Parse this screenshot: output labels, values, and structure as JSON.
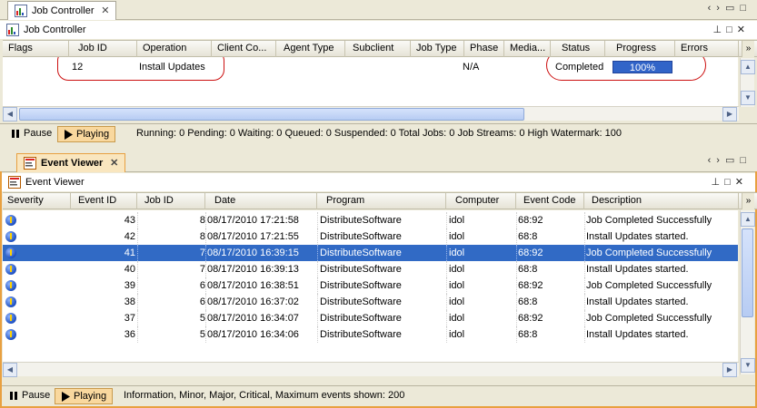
{
  "job_controller": {
    "tab_label": "Job Controller",
    "title": "Job Controller",
    "columns": [
      "Flags",
      "Job ID",
      "Operation",
      "Client Co...",
      "Agent Type",
      "Subclient",
      "Job Type",
      "Phase",
      "Media...",
      "Status",
      "Progress",
      "Errors"
    ],
    "job": {
      "job_id": "12",
      "operation": "Install Updates",
      "phase": "N/A",
      "status": "Completed",
      "progress_label": "100%",
      "progress": 1.0
    },
    "pause_label": "Pause",
    "playing_label": "Playing",
    "status_text": "Running: 0 Pending: 0 Waiting: 0 Queued: 0 Suspended: 0 Total Jobs: 0 Job Streams: 0 High Watermark: 100"
  },
  "event_viewer": {
    "tab_label": "Event Viewer",
    "title": "Event Viewer",
    "columns": [
      "Severity",
      "Event ID",
      "Job ID",
      "Date",
      "Program",
      "Computer",
      "Event Code",
      "Description"
    ],
    "rows": [
      {
        "event_id": "43",
        "job_id": "8",
        "date": "08/17/2010 17:21:58",
        "program": "DistributeSoftware",
        "computer": "idol",
        "code": "68:92",
        "description": "Job Completed Successfully"
      },
      {
        "event_id": "42",
        "job_id": "8",
        "date": "08/17/2010 17:21:55",
        "program": "DistributeSoftware",
        "computer": "idol",
        "code": "68:8",
        "description": "Install Updates started."
      },
      {
        "event_id": "41",
        "job_id": "7",
        "date": "08/17/2010 16:39:15",
        "program": "DistributeSoftware",
        "computer": "idol",
        "code": "68:92",
        "description": "Job Completed Successfully"
      },
      {
        "event_id": "40",
        "job_id": "7",
        "date": "08/17/2010 16:39:13",
        "program": "DistributeSoftware",
        "computer": "idol",
        "code": "68:8",
        "description": "Install Updates started."
      },
      {
        "event_id": "39",
        "job_id": "6",
        "date": "08/17/2010 16:38:51",
        "program": "DistributeSoftware",
        "computer": "idol",
        "code": "68:92",
        "description": "Job Completed Successfully"
      },
      {
        "event_id": "38",
        "job_id": "6",
        "date": "08/17/2010 16:37:02",
        "program": "DistributeSoftware",
        "computer": "idol",
        "code": "68:8",
        "description": "Install Updates started."
      },
      {
        "event_id": "37",
        "job_id": "5",
        "date": "08/17/2010 16:34:07",
        "program": "DistributeSoftware",
        "computer": "idol",
        "code": "68:92",
        "description": "Job Completed Successfully"
      },
      {
        "event_id": "36",
        "job_id": "5",
        "date": "08/17/2010 16:34:06",
        "program": "DistributeSoftware",
        "computer": "idol",
        "code": "68:8",
        "description": "Install Updates started."
      }
    ],
    "selected_row": 2,
    "pause_label": "Pause",
    "playing_label": "Playing",
    "status_text": "Information, Minor, Major, Critical, Maximum events shown: 200"
  },
  "icons": {
    "pause": "pause-icon",
    "play": "play-icon",
    "severity": "information-icon"
  },
  "colors": {
    "selection": "#316ac5",
    "progress": "#3164c8",
    "active_tab": "#f9e6bf",
    "annotation": "#cc1010"
  }
}
